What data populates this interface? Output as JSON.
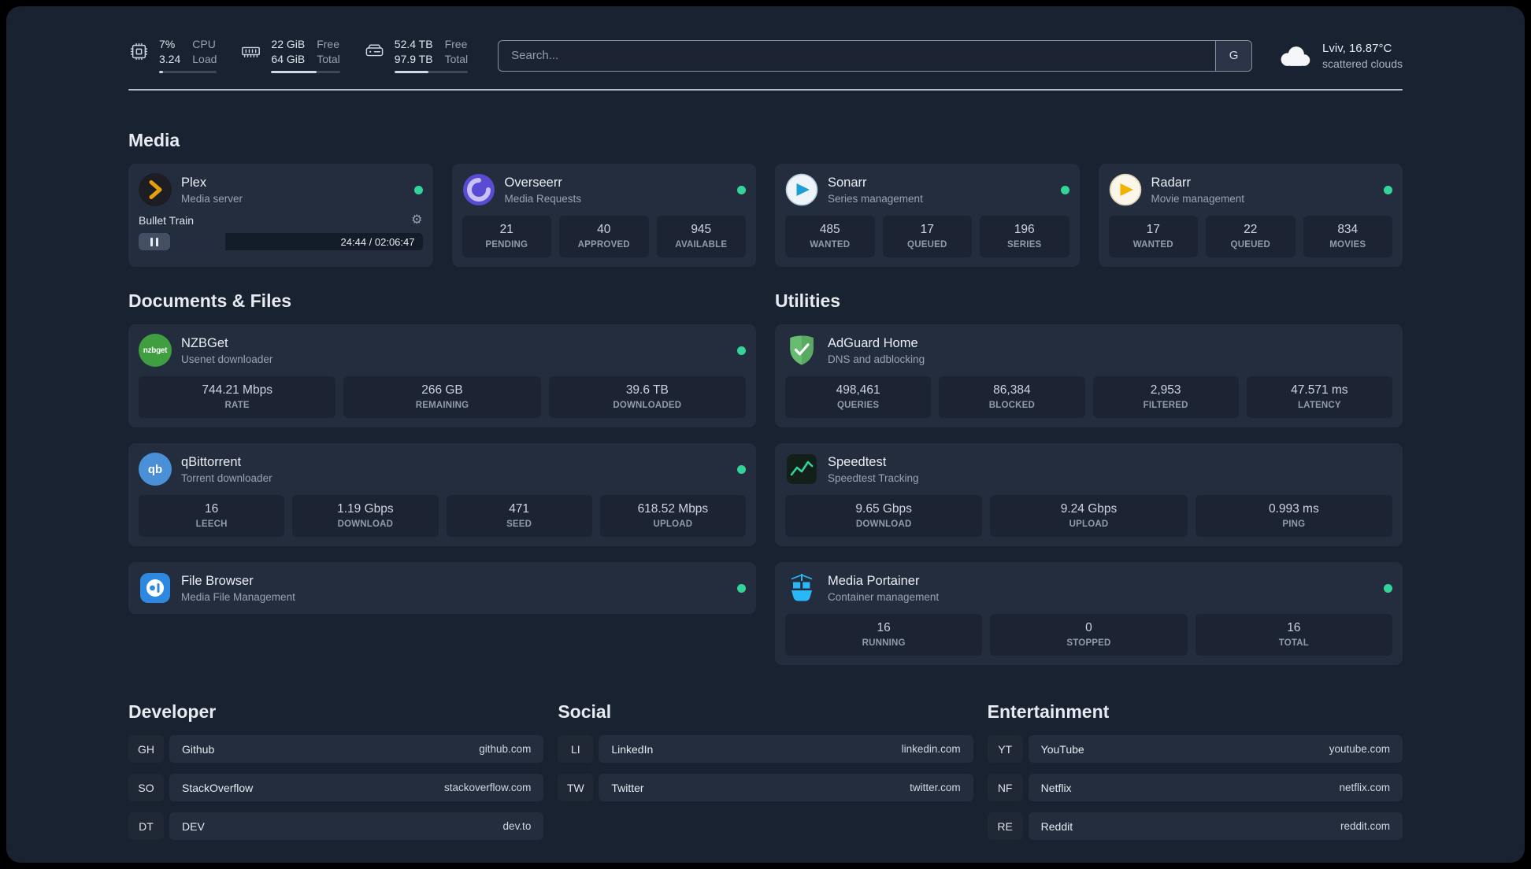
{
  "colors": {
    "page_background": "#192231",
    "card_background": "#242d3e",
    "stat_background": "#1c2433",
    "status_dot_green": "#34d399",
    "plex_orange": "#e5a00d",
    "overseerr_purple": "#5a4bd4",
    "sonarr_blue": "#1e9fd4",
    "radarr_gold": "#f0b400",
    "nzbget_green": "#3f9e3f",
    "qbittorrent_blue": "#4a90d9",
    "filebrowser_blue": "#2f88e0",
    "adguard_green": "#68bc71",
    "speedtest_green": "#34d399",
    "portainer_blue": "#29b8f5"
  },
  "icons": {
    "gear_glyph": "⚙"
  },
  "topbar": {
    "cpu": {
      "icon": "cpu-icon",
      "values": [
        "7%",
        "3.24"
      ],
      "labels": [
        "CPU",
        "Load"
      ],
      "bar_percent": 7
    },
    "memory": {
      "icon": "memory-icon",
      "values": [
        "22 GiB",
        "64 GiB"
      ],
      "labels": [
        "Free",
        "Total"
      ],
      "bar_percent": 65.6
    },
    "disk": {
      "icon": "disk-icon",
      "values": [
        "52.4 TB",
        "97.9 TB"
      ],
      "labels": [
        "Free",
        "Total"
      ],
      "bar_percent": 46.5
    },
    "search": {
      "placeholder": "Search...",
      "provider_label": "G"
    },
    "weather": {
      "icon": "cloud-icon",
      "location_temp": "Lviv, 16.87°C",
      "condition": "scattered clouds"
    }
  },
  "sections": {
    "media_title": "Media",
    "documents_title": "Documents & Files",
    "utilities_title": "Utilities"
  },
  "services": {
    "plex": {
      "icon": "plex-icon",
      "name": "Plex",
      "description": "Media server",
      "status": "online",
      "player": {
        "title": "Bullet Train",
        "time": "24:44 / 02:06:47",
        "progress_percent": 19.5
      }
    },
    "overseerr": {
      "icon": "overseerr-icon",
      "name": "Overseerr",
      "description": "Media Requests",
      "status": "online",
      "stats": [
        {
          "value": "21",
          "label": "PENDING"
        },
        {
          "value": "40",
          "label": "APPROVED"
        },
        {
          "value": "945",
          "label": "AVAILABLE"
        }
      ]
    },
    "sonarr": {
      "icon": "sonarr-icon",
      "name": "Sonarr",
      "description": "Series management",
      "status": "online",
      "stats": [
        {
          "value": "485",
          "label": "WANTED"
        },
        {
          "value": "17",
          "label": "QUEUED"
        },
        {
          "value": "196",
          "label": "SERIES"
        }
      ]
    },
    "radarr": {
      "icon": "radarr-icon",
      "name": "Radarr",
      "description": "Movie management",
      "status": "online",
      "stats": [
        {
          "value": "17",
          "label": "WANTED"
        },
        {
          "value": "22",
          "label": "QUEUED"
        },
        {
          "value": "834",
          "label": "MOVIES"
        }
      ]
    },
    "nzbget": {
      "icon": "nzbget-icon",
      "icon_text": "nzbget",
      "name": "NZBGet",
      "description": "Usenet downloader",
      "status": "online",
      "stats": [
        {
          "value": "744.21 Mbps",
          "label": "RATE"
        },
        {
          "value": "266 GB",
          "label": "REMAINING"
        },
        {
          "value": "39.6 TB",
          "label": "DOWNLOADED"
        }
      ]
    },
    "qbittorrent": {
      "icon": "qbittorrent-icon",
      "icon_text": "qb",
      "name": "qBittorrent",
      "description": "Torrent downloader",
      "status": "online",
      "stats": [
        {
          "value": "16",
          "label": "LEECH"
        },
        {
          "value": "1.19 Gbps",
          "label": "DOWNLOAD"
        },
        {
          "value": "471",
          "label": "SEED"
        },
        {
          "value": "618.52 Mbps",
          "label": "UPLOAD"
        }
      ]
    },
    "filebrowser": {
      "icon": "filebrowser-icon",
      "name": "File Browser",
      "description": "Media File Management",
      "status": "online"
    },
    "adguard": {
      "icon": "adguard-icon",
      "name": "AdGuard Home",
      "description": "DNS and adblocking",
      "stats": [
        {
          "value": "498,461",
          "label": "QUERIES"
        },
        {
          "value": "86,384",
          "label": "BLOCKED"
        },
        {
          "value": "2,953",
          "label": "FILTERED"
        },
        {
          "value": "47.571 ms",
          "label": "LATENCY"
        }
      ]
    },
    "speedtest": {
      "icon": "speedtest-icon",
      "name": "Speedtest",
      "description": "Speedtest Tracking",
      "stats": [
        {
          "value": "9.65 Gbps",
          "label": "DOWNLOAD"
        },
        {
          "value": "9.24 Gbps",
          "label": "UPLOAD"
        },
        {
          "value": "0.993 ms",
          "label": "PING"
        }
      ]
    },
    "portainer": {
      "icon": "portainer-icon",
      "name": "Media Portainer",
      "description": "Container management",
      "status": "online",
      "stats": [
        {
          "value": "16",
          "label": "RUNNING"
        },
        {
          "value": "0",
          "label": "STOPPED"
        },
        {
          "value": "16",
          "label": "TOTAL"
        }
      ]
    }
  },
  "bookmarks": [
    {
      "title": "Developer",
      "items": [
        {
          "abbr": "GH",
          "name": "Github",
          "url": "github.com"
        },
        {
          "abbr": "SO",
          "name": "StackOverflow",
          "url": "stackoverflow.com"
        },
        {
          "abbr": "DT",
          "name": "DEV",
          "url": "dev.to"
        }
      ]
    },
    {
      "title": "Social",
      "items": [
        {
          "abbr": "LI",
          "name": "LinkedIn",
          "url": "linkedin.com"
        },
        {
          "abbr": "TW",
          "name": "Twitter",
          "url": "twitter.com"
        }
      ]
    },
    {
      "title": "Entertainment",
      "items": [
        {
          "abbr": "YT",
          "name": "YouTube",
          "url": "youtube.com"
        },
        {
          "abbr": "NF",
          "name": "Netflix",
          "url": "netflix.com"
        },
        {
          "abbr": "RE",
          "name": "Reddit",
          "url": "reddit.com"
        }
      ]
    }
  ]
}
